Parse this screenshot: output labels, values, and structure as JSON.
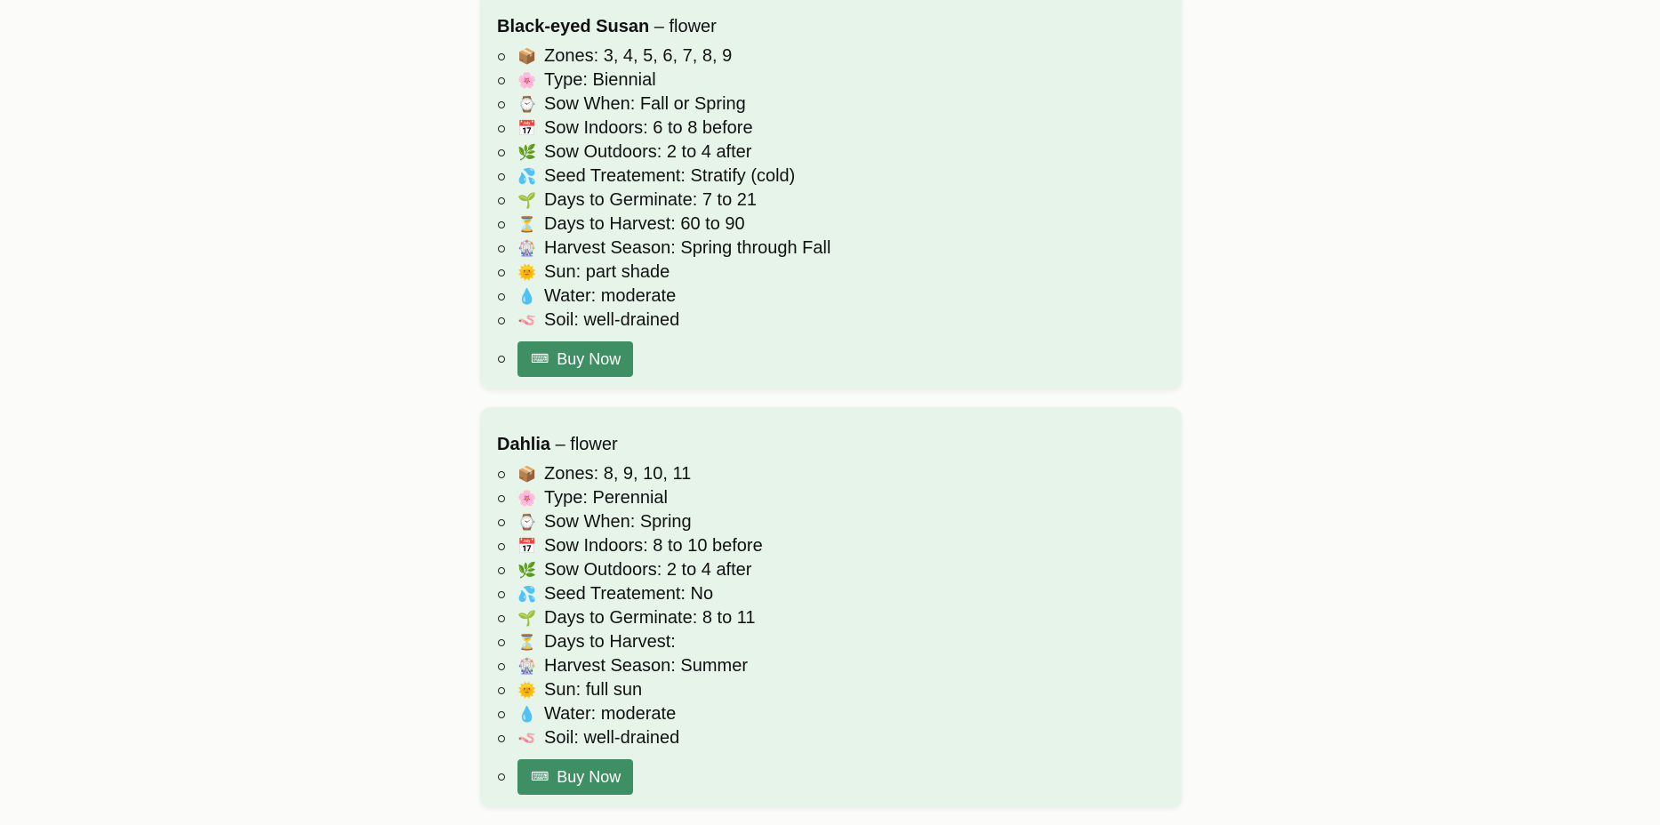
{
  "plants": [
    {
      "name": "Black-eyed Susan",
      "category": "flower",
      "details": [
        {
          "icon": "📦",
          "icon_name": "package-icon",
          "label": "Zones: 3, 4, 5, 6, 7, 8, 9"
        },
        {
          "icon": "🌸",
          "icon_name": "cherry-blossom-icon",
          "label": "Type: Biennial"
        },
        {
          "icon": "⌚",
          "icon_name": "watch-icon",
          "label": "Sow When: Fall or Spring"
        },
        {
          "icon": "📅",
          "icon_name": "calendar-icon",
          "label": "Sow Indoors: 6 to 8 before"
        },
        {
          "icon": "🌿",
          "icon_name": "herb-icon",
          "label": "Sow Outdoors: 2 to 4 after"
        },
        {
          "icon": "💦",
          "icon_name": "water-drops-icon",
          "label": "Seed Treatement: Stratify (cold)"
        },
        {
          "icon": "🌱",
          "icon_name": "seedling-icon",
          "label": "Days to Germinate: 7 to 21"
        },
        {
          "icon": "⏳",
          "icon_name": "hourglass-icon",
          "label": "Days to Harvest: 60 to 90"
        },
        {
          "icon": "🎡",
          "icon_name": "ferris-wheel-icon",
          "label": "Harvest Season: Spring through Fall"
        },
        {
          "icon": "🌞",
          "icon_name": "sun-face-icon",
          "label": "Sun: part shade"
        },
        {
          "icon": "💧",
          "icon_name": "droplet-icon",
          "label": "Water: moderate"
        },
        {
          "icon": "🪱",
          "icon_name": "worm-icon",
          "label": "Soil: well-drained"
        }
      ],
      "buy_label": "Buy Now",
      "buy_icon": "⌨"
    },
    {
      "name": "Dahlia",
      "category": "flower",
      "details": [
        {
          "icon": "📦",
          "icon_name": "package-icon",
          "label": "Zones: 8, 9, 10, 11"
        },
        {
          "icon": "🌸",
          "icon_name": "cherry-blossom-icon",
          "label": "Type: Perennial"
        },
        {
          "icon": "⌚",
          "icon_name": "watch-icon",
          "label": "Sow When: Spring"
        },
        {
          "icon": "📅",
          "icon_name": "calendar-icon",
          "label": "Sow Indoors: 8 to 10 before"
        },
        {
          "icon": "🌿",
          "icon_name": "herb-icon",
          "label": "Sow Outdoors: 2 to 4 after"
        },
        {
          "icon": "💦",
          "icon_name": "water-drops-icon",
          "label": "Seed Treatement: No"
        },
        {
          "icon": "🌱",
          "icon_name": "seedling-icon",
          "label": "Days to Germinate: 8 to 11"
        },
        {
          "icon": "⏳",
          "icon_name": "hourglass-icon",
          "label": "Days to Harvest:"
        },
        {
          "icon": "🎡",
          "icon_name": "ferris-wheel-icon",
          "label": "Harvest Season: Summer"
        },
        {
          "icon": "🌞",
          "icon_name": "sun-face-icon",
          "label": "Sun: full sun"
        },
        {
          "icon": "💧",
          "icon_name": "droplet-icon",
          "label": "Water: moderate"
        },
        {
          "icon": "🪱",
          "icon_name": "worm-icon",
          "label": "Soil: well-drained"
        }
      ],
      "buy_label": "Buy Now",
      "buy_icon": "⌨"
    }
  ],
  "colors": {
    "page_background": "#fbfcfa",
    "card_background": "#e6f4ea",
    "button_background": "#3f8f65",
    "button_text": "#ffffff"
  }
}
